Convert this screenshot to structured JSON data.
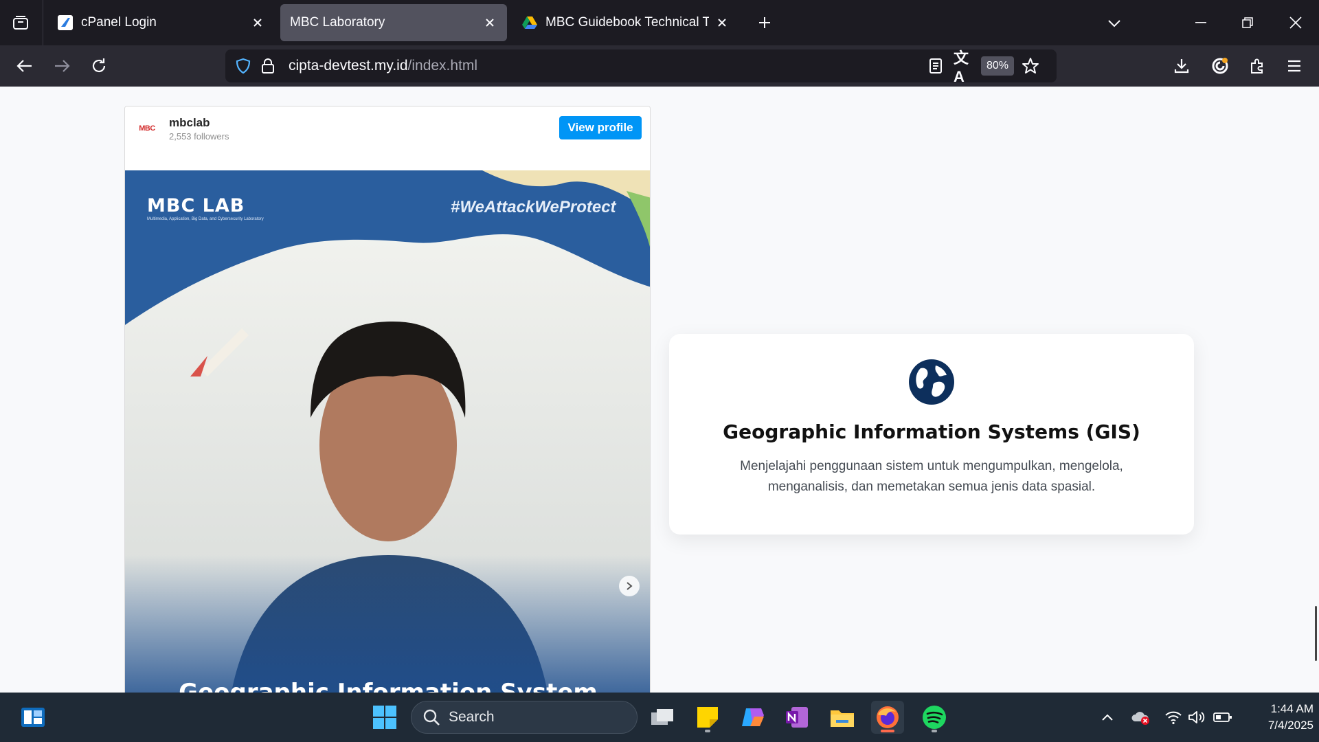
{
  "browser": {
    "tabs": [
      {
        "title": "cPanel Login",
        "active": false
      },
      {
        "title": "MBC Laboratory",
        "active": true
      },
      {
        "title": "MBC Guidebook Technical Test - Google Drive",
        "active": false
      }
    ],
    "url": {
      "domain": "cipta-devtest.my.id",
      "path": "/index.html"
    },
    "zoom": "80%"
  },
  "instagram_embed": {
    "username": "mbclab",
    "followers": "2,553 followers",
    "view_profile_label": "View profile",
    "logo_text": "MBC LAB",
    "logo_subtitle": "Multimedia, Application, Big Data, and Cybersecurity Laboratory",
    "hashtag": "#WeAttackWeProtect",
    "caption": "Geographic Information System"
  },
  "gis_card": {
    "icon": "globe-icon",
    "title": "Geographic Information Systems (GIS)",
    "description": "Menjelajahi penggunaan sistem untuk mengumpulkan, mengelola, menganalisis, dan memetakan semua jenis data spasial."
  },
  "taskbar": {
    "search_placeholder": "Search",
    "time": "1:44 AM",
    "date": "7/4/2025"
  },
  "colors": {
    "accent_blue": "#0095f6",
    "navy": "#0d2f5c",
    "tab_bar": "#1c1b22",
    "nav_bar": "#2b2a33"
  }
}
